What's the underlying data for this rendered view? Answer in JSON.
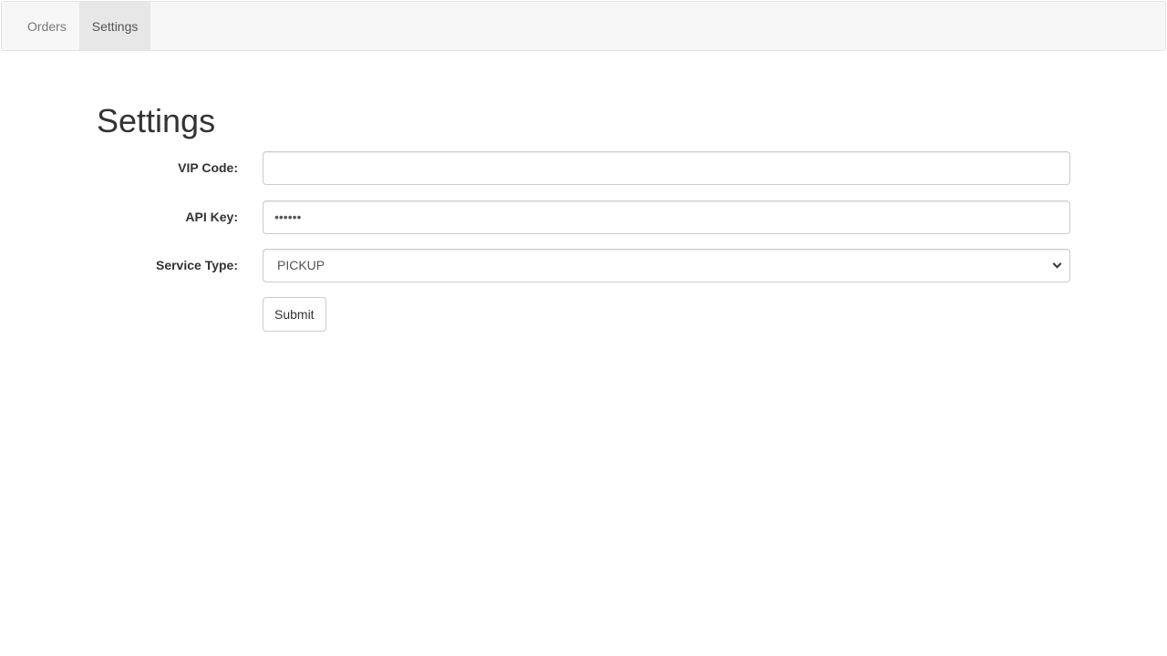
{
  "nav": {
    "items": [
      {
        "label": "Orders",
        "active": false
      },
      {
        "label": "Settings",
        "active": true
      }
    ]
  },
  "page": {
    "title": "Settings"
  },
  "form": {
    "vip_code": {
      "label": "VIP Code:",
      "value": ""
    },
    "api_key": {
      "label": "API Key:",
      "value": "••••••"
    },
    "service_type": {
      "label": "Service Type:",
      "selected": "PICKUP"
    },
    "submit_label": "Submit"
  },
  "colors": {
    "navbar_bg": "#f7f7f7",
    "nav_active_bg": "#e7e7e7",
    "input_border": "#cccccc",
    "text": "#333333"
  }
}
